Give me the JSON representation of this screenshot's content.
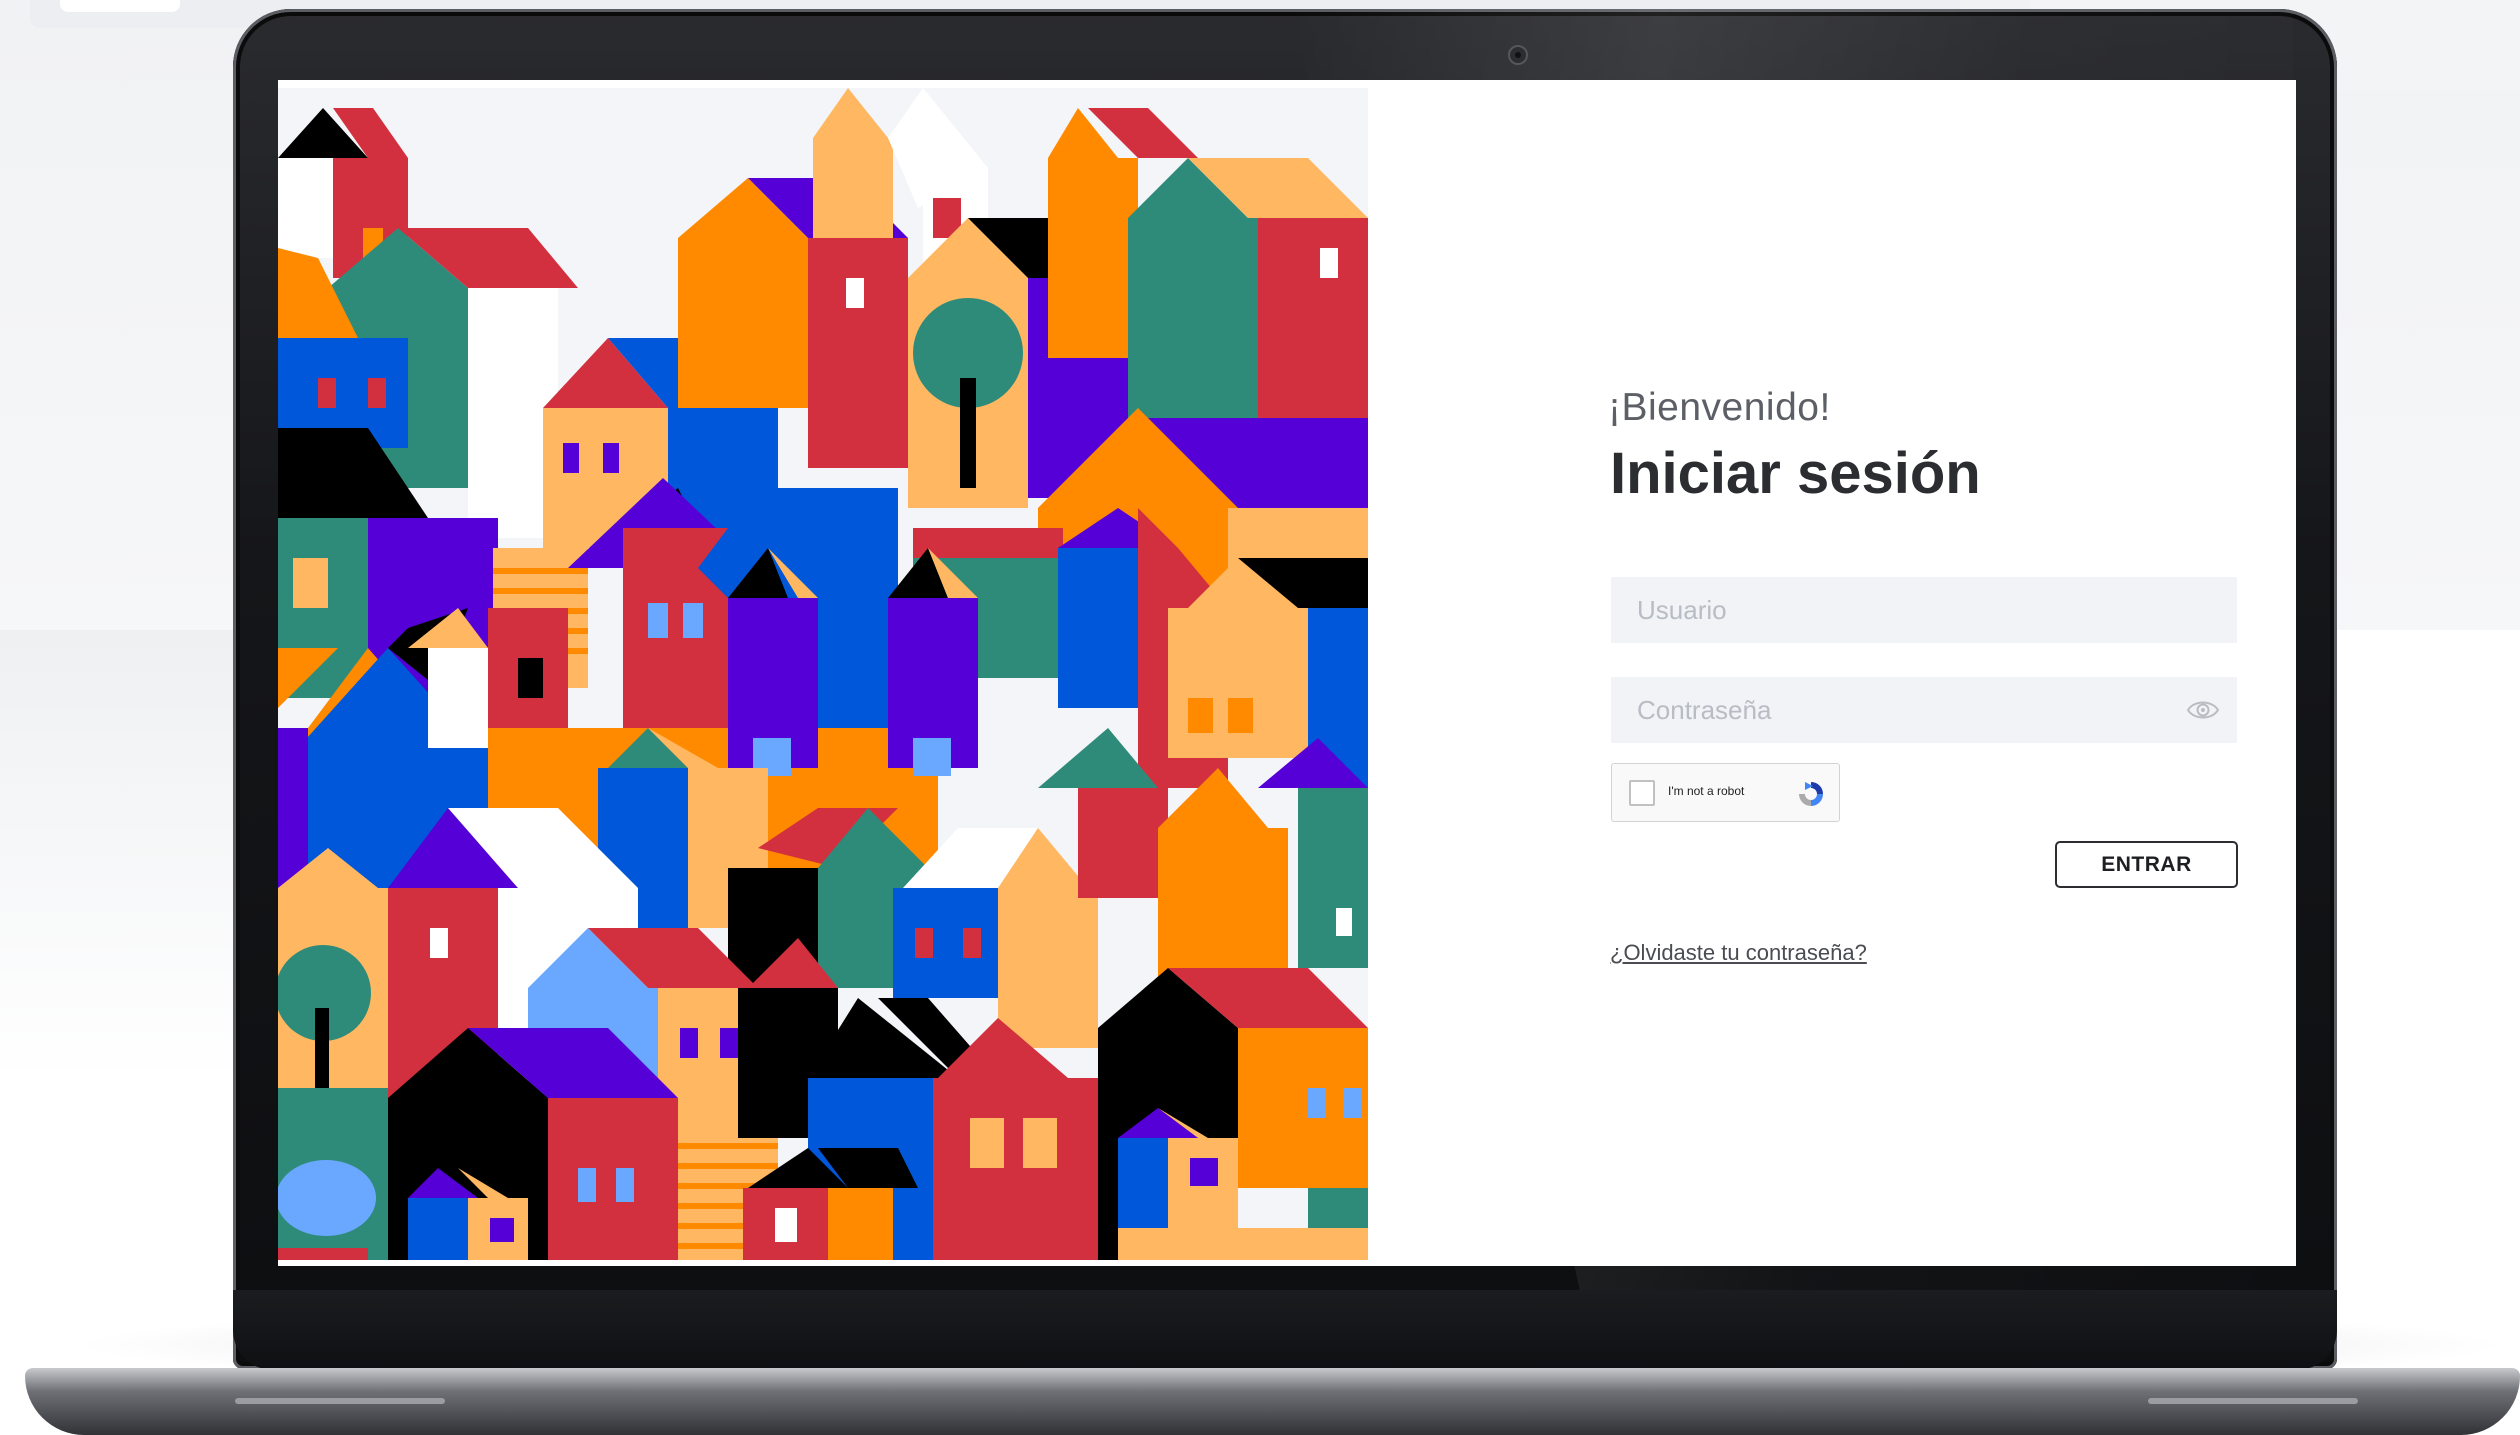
{
  "login": {
    "welcome": "¡Bienvenido!",
    "title": "Iniciar sesión",
    "username_placeholder": "Usuario",
    "password_placeholder": "Contraseña",
    "captcha_label": "I'm not a robot",
    "submit_label": "ENTRAR",
    "forgot_label": "¿Olvidaste tu contraseña?"
  },
  "icons": {
    "password_toggle": "eye-icon",
    "captcha": "recaptcha-icon"
  },
  "colors": {
    "accent": "#2b2d31",
    "field_bg": "#f1f3f6",
    "illustration_palette": [
      "#d3303f",
      "#ff8a00",
      "#ffb861",
      "#2e8b7a",
      "#0057d9",
      "#5600d8",
      "#000000",
      "#6aa8ff"
    ]
  }
}
